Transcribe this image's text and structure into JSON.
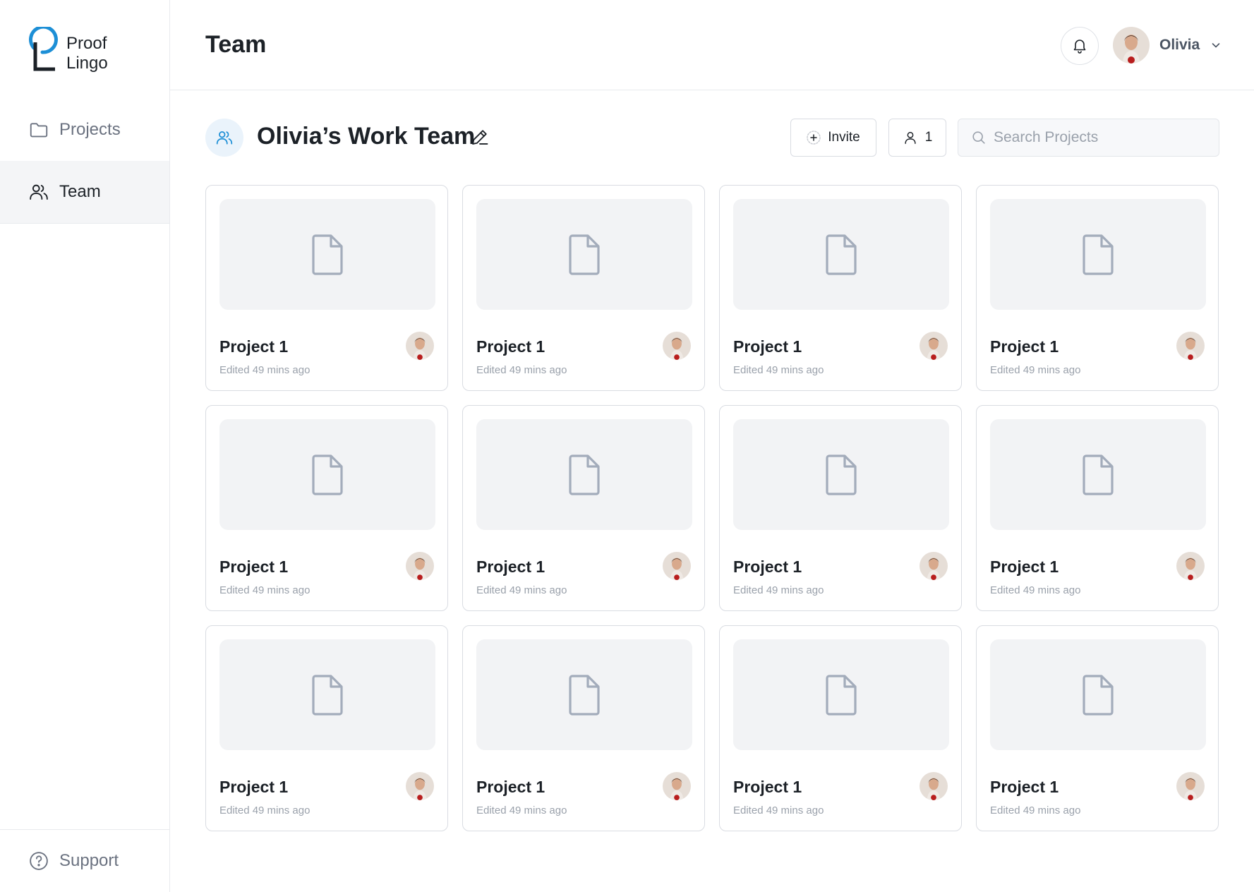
{
  "brand": {
    "line1": "Proof",
    "line2": "Lingo",
    "accent": "#1d8fd6"
  },
  "sidebar": {
    "items": [
      {
        "label": "Projects",
        "icon": "folder-icon"
      },
      {
        "label": "Team",
        "icon": "users-icon"
      }
    ],
    "support_label": "Support"
  },
  "header": {
    "title": "Team",
    "user_name": "Olivia"
  },
  "team": {
    "name": "Olivia’s Work Team",
    "invite_label": "Invite",
    "member_count": "1",
    "search_placeholder": "Search Projects"
  },
  "projects": [
    {
      "title": "Project 1",
      "edited": "Edited 49 mins ago"
    },
    {
      "title": "Project 1",
      "edited": "Edited 49 mins ago"
    },
    {
      "title": "Project 1",
      "edited": "Edited 49 mins ago"
    },
    {
      "title": "Project 1",
      "edited": "Edited 49 mins ago"
    },
    {
      "title": "Project 1",
      "edited": "Edited 49 mins ago"
    },
    {
      "title": "Project 1",
      "edited": "Edited 49 mins ago"
    },
    {
      "title": "Project 1",
      "edited": "Edited 49 mins ago"
    },
    {
      "title": "Project 1",
      "edited": "Edited 49 mins ago"
    },
    {
      "title": "Project 1",
      "edited": "Edited 49 mins ago"
    },
    {
      "title": "Project 1",
      "edited": "Edited 49 mins ago"
    },
    {
      "title": "Project 1",
      "edited": "Edited 49 mins ago"
    },
    {
      "title": "Project 1",
      "edited": "Edited 49 mins ago"
    }
  ]
}
